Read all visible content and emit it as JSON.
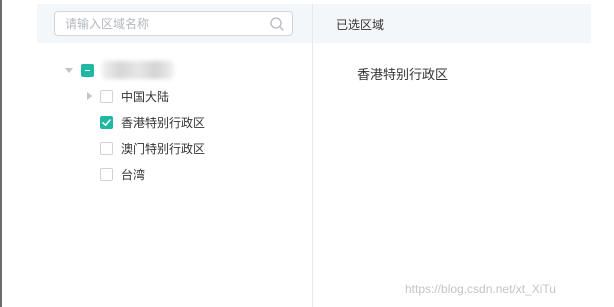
{
  "search": {
    "placeholder": "请输入区域名称"
  },
  "tree": {
    "root": {
      "state": "partial",
      "expanded": true,
      "label_blurred": true
    },
    "children": [
      {
        "label": "中国大陆",
        "state": "unchecked",
        "has_children": true,
        "expanded": false
      },
      {
        "label": "香港特别行政区",
        "state": "checked",
        "has_children": false
      },
      {
        "label": "澳门特别行政区",
        "state": "unchecked",
        "has_children": false
      },
      {
        "label": "台湾",
        "state": "unchecked",
        "has_children": false
      }
    ]
  },
  "selected_panel": {
    "title": "已选区域",
    "items": [
      "香港特别行政区"
    ]
  },
  "watermark": "https://blog.csdn.net/xt_XiTu",
  "colors": {
    "accent": "#1fb8a3",
    "header_bg": "#f4f7f9",
    "border": "#d2d6db",
    "text": "#333333"
  },
  "icons": {
    "search": "search-icon",
    "expand": "caret-down-icon",
    "collapse": "caret-right-icon",
    "check": "checkmark-icon"
  }
}
